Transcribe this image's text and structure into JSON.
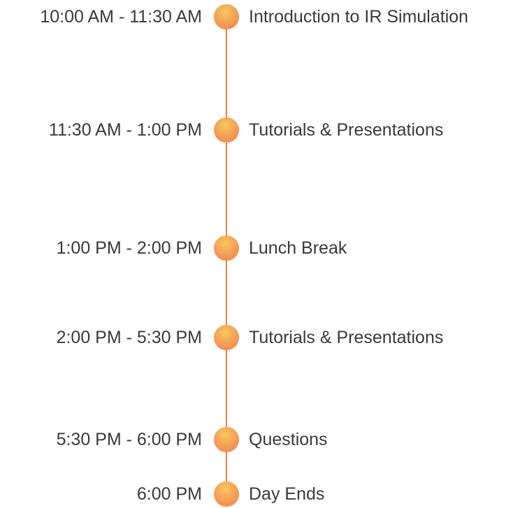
{
  "accent_color": "#e9824b",
  "dot_icon": "circle-marker-icon",
  "events": [
    {
      "time": "10:00 AM - 11:30 AM",
      "title": "Introduction to IR Simulation"
    },
    {
      "time": "11:30 AM - 1:00 PM",
      "title": "Tutorials & Presentations"
    },
    {
      "time": "1:00 PM - 2:00 PM",
      "title": "Lunch Break"
    },
    {
      "time": "2:00 PM - 5:30 PM",
      "title": "Tutorials & Presentations"
    },
    {
      "time": "5:30 PM - 6:00 PM",
      "title": "Questions"
    },
    {
      "time": "6:00 PM",
      "title": "Day Ends"
    }
  ]
}
